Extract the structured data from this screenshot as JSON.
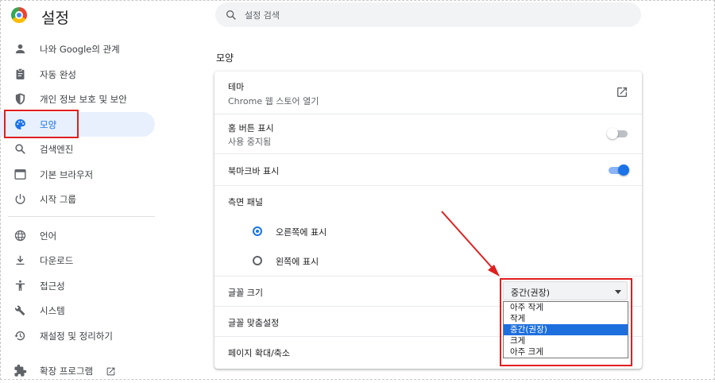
{
  "header": {
    "title": "설정",
    "search_placeholder": "설정 검색"
  },
  "sidebar": {
    "items": [
      {
        "label": "나와 Google의 관계",
        "icon": "person-icon"
      },
      {
        "label": "자동 완성",
        "icon": "clipboard-icon"
      },
      {
        "label": "개인 정보 보호 및 보안",
        "icon": "shield-icon"
      },
      {
        "label": "모양",
        "icon": "palette-icon",
        "active": true
      },
      {
        "label": "검색엔진",
        "icon": "search-icon"
      },
      {
        "label": "기본 브라우저",
        "icon": "browser-icon"
      },
      {
        "label": "시작 그룹",
        "icon": "power-icon"
      },
      {
        "label": "언어",
        "icon": "globe-icon"
      },
      {
        "label": "다운로드",
        "icon": "download-icon"
      },
      {
        "label": "접근성",
        "icon": "accessibility-icon"
      },
      {
        "label": "시스템",
        "icon": "wrench-icon"
      },
      {
        "label": "재설정 및 정리하기",
        "icon": "history-icon"
      },
      {
        "label": "확장 프로그램",
        "icon": "puzzle-icon"
      }
    ]
  },
  "main": {
    "section_title": "모양",
    "theme": {
      "title": "테마",
      "subtitle": "Chrome 웹 스토어 열기"
    },
    "home_button": {
      "title": "홈 버튼 표시",
      "subtitle": "사용 중지됨",
      "enabled": false
    },
    "bookmarks_bar": {
      "title": "북마크바 표시",
      "enabled": true
    },
    "side_panel": {
      "title": "측면 패널",
      "options": [
        {
          "label": "오른쪽에 표시",
          "selected": true
        },
        {
          "label": "왼쪽에 표시",
          "selected": false
        }
      ]
    },
    "font_size": {
      "title": "글꼴 크기",
      "selected": "중간(권장)",
      "options": [
        "아주 작게",
        "작게",
        "중간(권장)",
        "크게",
        "아주 크게"
      ],
      "selected_index": 2
    },
    "customize_fonts": {
      "title": "글꼴 맞춤설정"
    },
    "page_zoom": {
      "title": "페이지 확대/축소"
    }
  },
  "colors": {
    "accent": "#1a73e8",
    "annotation": "#e01f1f",
    "active_bg": "#e8f0fe"
  }
}
